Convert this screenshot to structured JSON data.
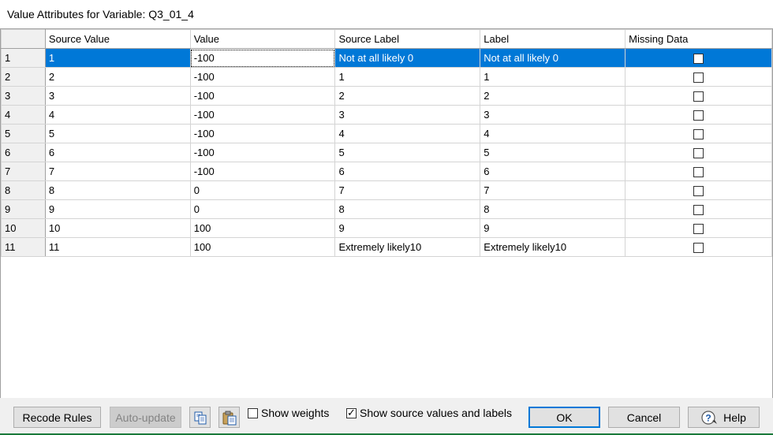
{
  "window": {
    "title": "Value Attributes for Variable: Q3_01_4"
  },
  "grid": {
    "columns": [
      "Source Value",
      "Value",
      "Source Label",
      "Label",
      "Missing Data"
    ],
    "rows": [
      {
        "num": "1",
        "source_value": "1",
        "value": "-100",
        "source_label": "Not at all likely 0",
        "label": "Not at all likely 0",
        "missing": false
      },
      {
        "num": "2",
        "source_value": "2",
        "value": "-100",
        "source_label": "1",
        "label": "1",
        "missing": false
      },
      {
        "num": "3",
        "source_value": "3",
        "value": "-100",
        "source_label": "2",
        "label": "2",
        "missing": false
      },
      {
        "num": "4",
        "source_value": "4",
        "value": "-100",
        "source_label": "3",
        "label": "3",
        "missing": false
      },
      {
        "num": "5",
        "source_value": "5",
        "value": "-100",
        "source_label": "4",
        "label": "4",
        "missing": false
      },
      {
        "num": "6",
        "source_value": "6",
        "value": "-100",
        "source_label": "5",
        "label": "5",
        "missing": false
      },
      {
        "num": "7",
        "source_value": "7",
        "value": "-100",
        "source_label": "6",
        "label": "6",
        "missing": false
      },
      {
        "num": "8",
        "source_value": "8",
        "value": "0",
        "source_label": "7",
        "label": "7",
        "missing": false
      },
      {
        "num": "9",
        "source_value": "9",
        "value": "0",
        "source_label": "8",
        "label": "8",
        "missing": false
      },
      {
        "num": "10",
        "source_value": "10",
        "value": "100",
        "source_label": "9",
        "label": "9",
        "missing": false
      },
      {
        "num": "11",
        "source_value": "11",
        "value": "100",
        "source_label": "Extremely likely10",
        "label": "Extremely likely10",
        "missing": false
      }
    ],
    "selected_row": "1",
    "selection_color": "#0078d7"
  },
  "buttons": {
    "recode_rules": "Recode Rules",
    "auto_update": "Auto-update",
    "ok": "OK",
    "cancel": "Cancel",
    "help": "Help",
    "copy_icon": "copy-icon",
    "paste_icon": "paste-icon",
    "help_icon": "help-icon"
  },
  "options": {
    "show_weights": {
      "label": "Show weights",
      "checked": false
    },
    "show_source": {
      "label": "Show source values and labels",
      "checked": true
    }
  }
}
